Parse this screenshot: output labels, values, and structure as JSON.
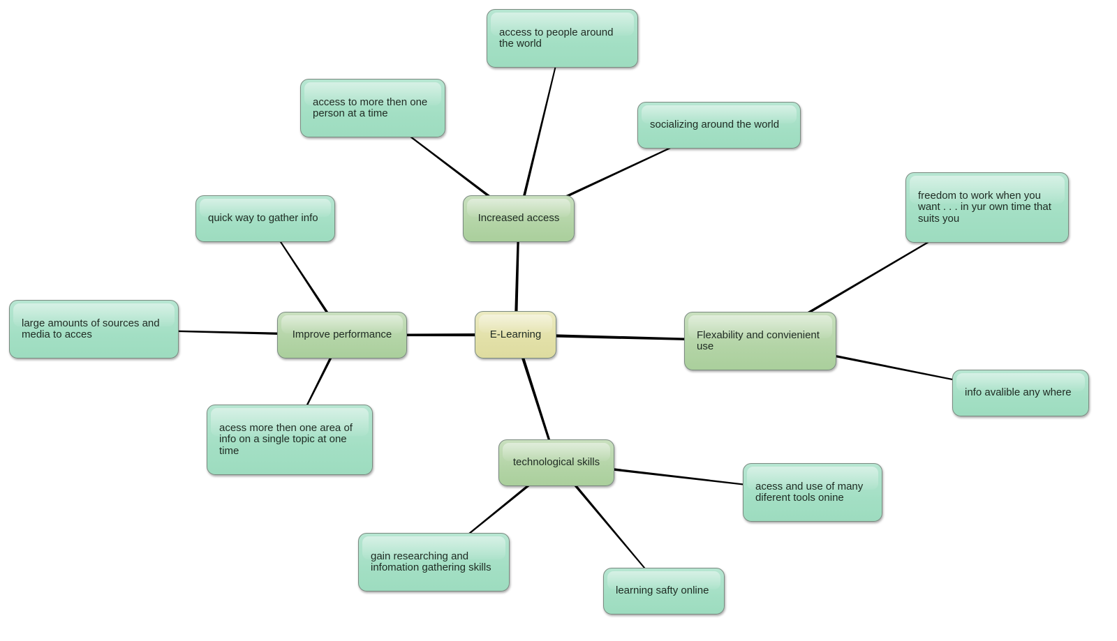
{
  "diagram": {
    "type": "mind-map",
    "colors": {
      "root_fill": "#e2e0a8",
      "branch_fill": "#b3d4a6",
      "leaf_fill": "#a3dfc4",
      "connector": "#000000",
      "text": "#1e2a22"
    },
    "root": {
      "id": "root",
      "label": "E-Learning"
    },
    "branches": [
      {
        "id": "b_access",
        "label": "Increased access",
        "parent": "root"
      },
      {
        "id": "b_perf",
        "label": "Improve performance",
        "parent": "root"
      },
      {
        "id": "b_flex",
        "label": "Flexability and convienient use",
        "parent": "root"
      },
      {
        "id": "b_tech",
        "label": "technological skills",
        "parent": "root"
      }
    ],
    "leaves": [
      {
        "id": "l_people",
        "label": "access to people around the world",
        "parent": "b_access"
      },
      {
        "id": "l_more",
        "label": "access to more then one person at a time",
        "parent": "b_access"
      },
      {
        "id": "l_social",
        "label": "socializing around the world",
        "parent": "b_access"
      },
      {
        "id": "l_quick",
        "label": "quick way to gather info",
        "parent": "b_perf"
      },
      {
        "id": "l_large",
        "label": "large amounts of sources and media to acces",
        "parent": "b_perf"
      },
      {
        "id": "l_area",
        "label": "acess more then one area of info on a single topic at one time",
        "parent": "b_perf"
      },
      {
        "id": "l_freedom",
        "label": "freedom to work when you want . . . in yur own time that suits you",
        "parent": "b_flex"
      },
      {
        "id": "l_avail",
        "label": "info avalible any where",
        "parent": "b_flex"
      },
      {
        "id": "l_tools",
        "label": "acess and use of many diferent tools onine",
        "parent": "b_tech"
      },
      {
        "id": "l_research",
        "label": "gain researching and infomation gathering skills",
        "parent": "b_tech"
      },
      {
        "id": "l_safety",
        "label": "learning safty online",
        "parent": "b_tech"
      }
    ]
  }
}
